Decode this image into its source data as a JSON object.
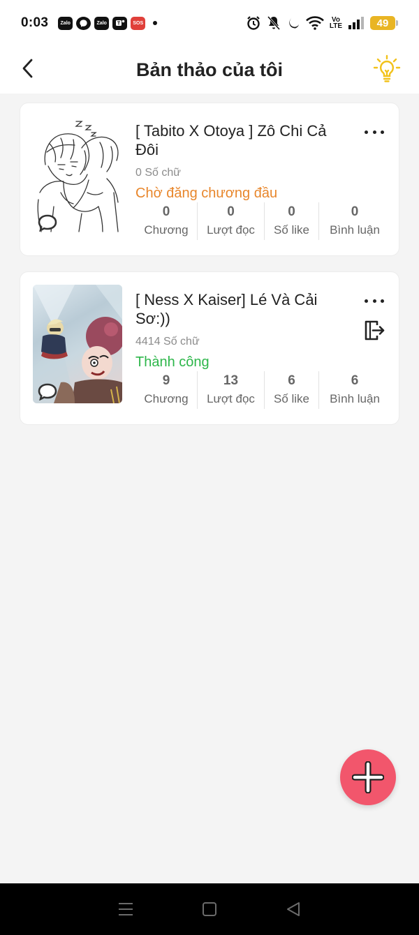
{
  "status_bar": {
    "time": "0:03",
    "notification_icons": [
      "zalo-icon",
      "messenger-icon",
      "zalo-icon",
      "teams-icon",
      "sos-icon"
    ],
    "zalo_label": "Zalo",
    "sos_label": "SOS",
    "volte_top": "Vo",
    "volte_bottom": "LTE",
    "battery_level": "49"
  },
  "app_bar": {
    "title": "Bản thảo của tôi"
  },
  "stories": [
    {
      "title": "[ Tabito X Otoya ] Zô Chi Cả Đôi",
      "word_count": "0 Số chữ",
      "status": "Chờ đăng chương đầu",
      "stats": [
        {
          "value": "0",
          "label": "Chương"
        },
        {
          "value": "0",
          "label": "Lượt đọc"
        },
        {
          "value": "0",
          "label": "Số like"
        },
        {
          "value": "0",
          "label": "Bình luận"
        }
      ]
    },
    {
      "title": "[ Ness X Kaiser] Lé Và Cải Sơ:))",
      "word_count": "4414 Số chữ",
      "status": "Thành công",
      "stats": [
        {
          "value": "9",
          "label": "Chương"
        },
        {
          "value": "13",
          "label": "Lượt đọc"
        },
        {
          "value": "6",
          "label": "Số like"
        },
        {
          "value": "6",
          "label": "Bình luận"
        }
      ]
    }
  ],
  "colors": {
    "pending": "#e8862b",
    "success": "#2db64a",
    "fab": "#f2566c",
    "bulb": "#f2c21b"
  }
}
